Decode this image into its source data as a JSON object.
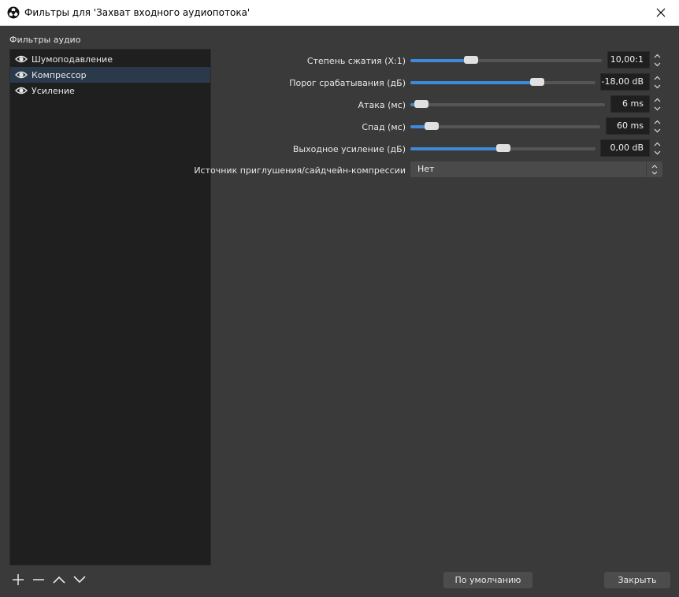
{
  "window": {
    "title": "Фильтры для 'Захват входного аудиопотока'"
  },
  "filters_label": "Фильтры аудио",
  "filters": [
    {
      "label": "Шумоподавление",
      "selected": false
    },
    {
      "label": "Компрессор",
      "selected": true
    },
    {
      "label": "Усиление",
      "selected": false
    }
  ],
  "properties": {
    "ratio": {
      "label": "Степень сжатия (X:1)",
      "value": "10,00:1",
      "level": 0.3
    },
    "threshold": {
      "label": "Порог срабатывания (дБ)",
      "value": "-18,00 dB",
      "level": 0.7
    },
    "attack": {
      "label": "Атака (мс)",
      "value": "6 ms",
      "level": 0.02
    },
    "release": {
      "label": "Спад (мс)",
      "value": "60 ms",
      "level": 0.08
    },
    "output_gain": {
      "label": "Выходное усиление (дБ)",
      "value": "0,00 dB",
      "level": 0.5
    },
    "sidechain": {
      "label": "Источник приглушения/сайдчейн-компрессии",
      "value": "Нет"
    }
  },
  "buttons": {
    "defaults": "По умолчанию",
    "close": "Закрыть"
  },
  "colors": {
    "accent": "#3f8ad8",
    "background": "#3a3a3a",
    "list_bg": "#1f1f1f"
  }
}
